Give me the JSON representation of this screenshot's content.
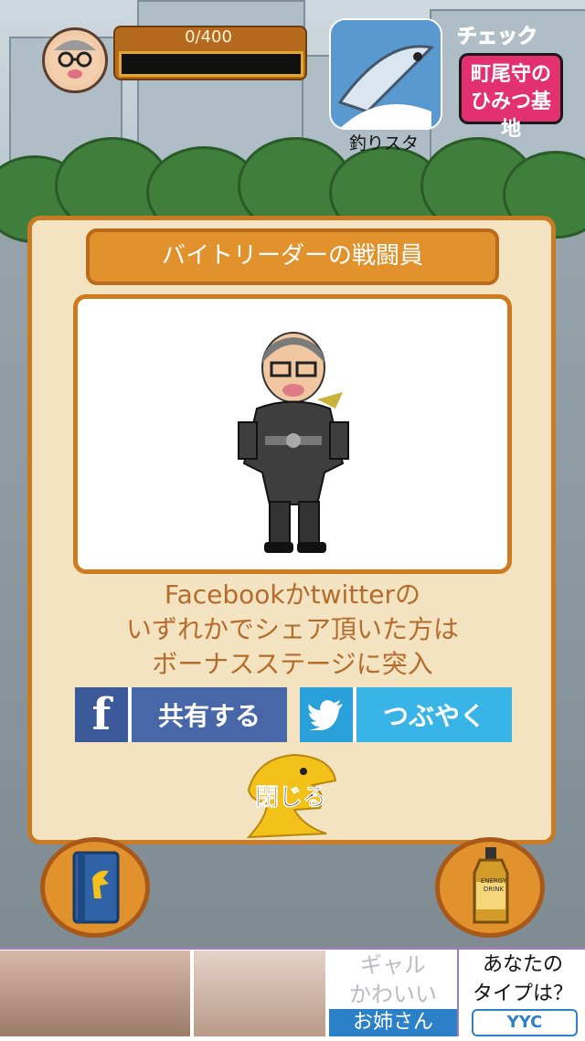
{
  "hud": {
    "progress_text": "0/400",
    "progress_fraction": 0
  },
  "app_promo": {
    "label": "釣りスタ"
  },
  "side_promo": {
    "check": "チェック",
    "line1": "町尾守の",
    "line2": "ひみつ基地"
  },
  "dialog": {
    "title": "バイトリーダーの戦闘員",
    "message_line1": "Facebookかtwitterの",
    "message_line2": "いずれかでシェア頂いた方は",
    "message_line3": "ボーナスステージに突入",
    "facebook_icon": "f",
    "facebook_label": "共有する",
    "twitter_label": "つぶやく",
    "close_label": "閉じる"
  },
  "bottom_items": {
    "drink_label": "ENERGY DRINK"
  },
  "ad": {
    "word1": "ギャル",
    "word2": "かわいい",
    "word3": "お姉さん",
    "right_line1": "あなたの",
    "right_line2": "タイプは？",
    "logo": "YYC"
  },
  "colors": {
    "panel": "#f4e3c0",
    "accent": "#e2922d",
    "facebook": "#3b5998",
    "twitter": "#38b4e7"
  }
}
